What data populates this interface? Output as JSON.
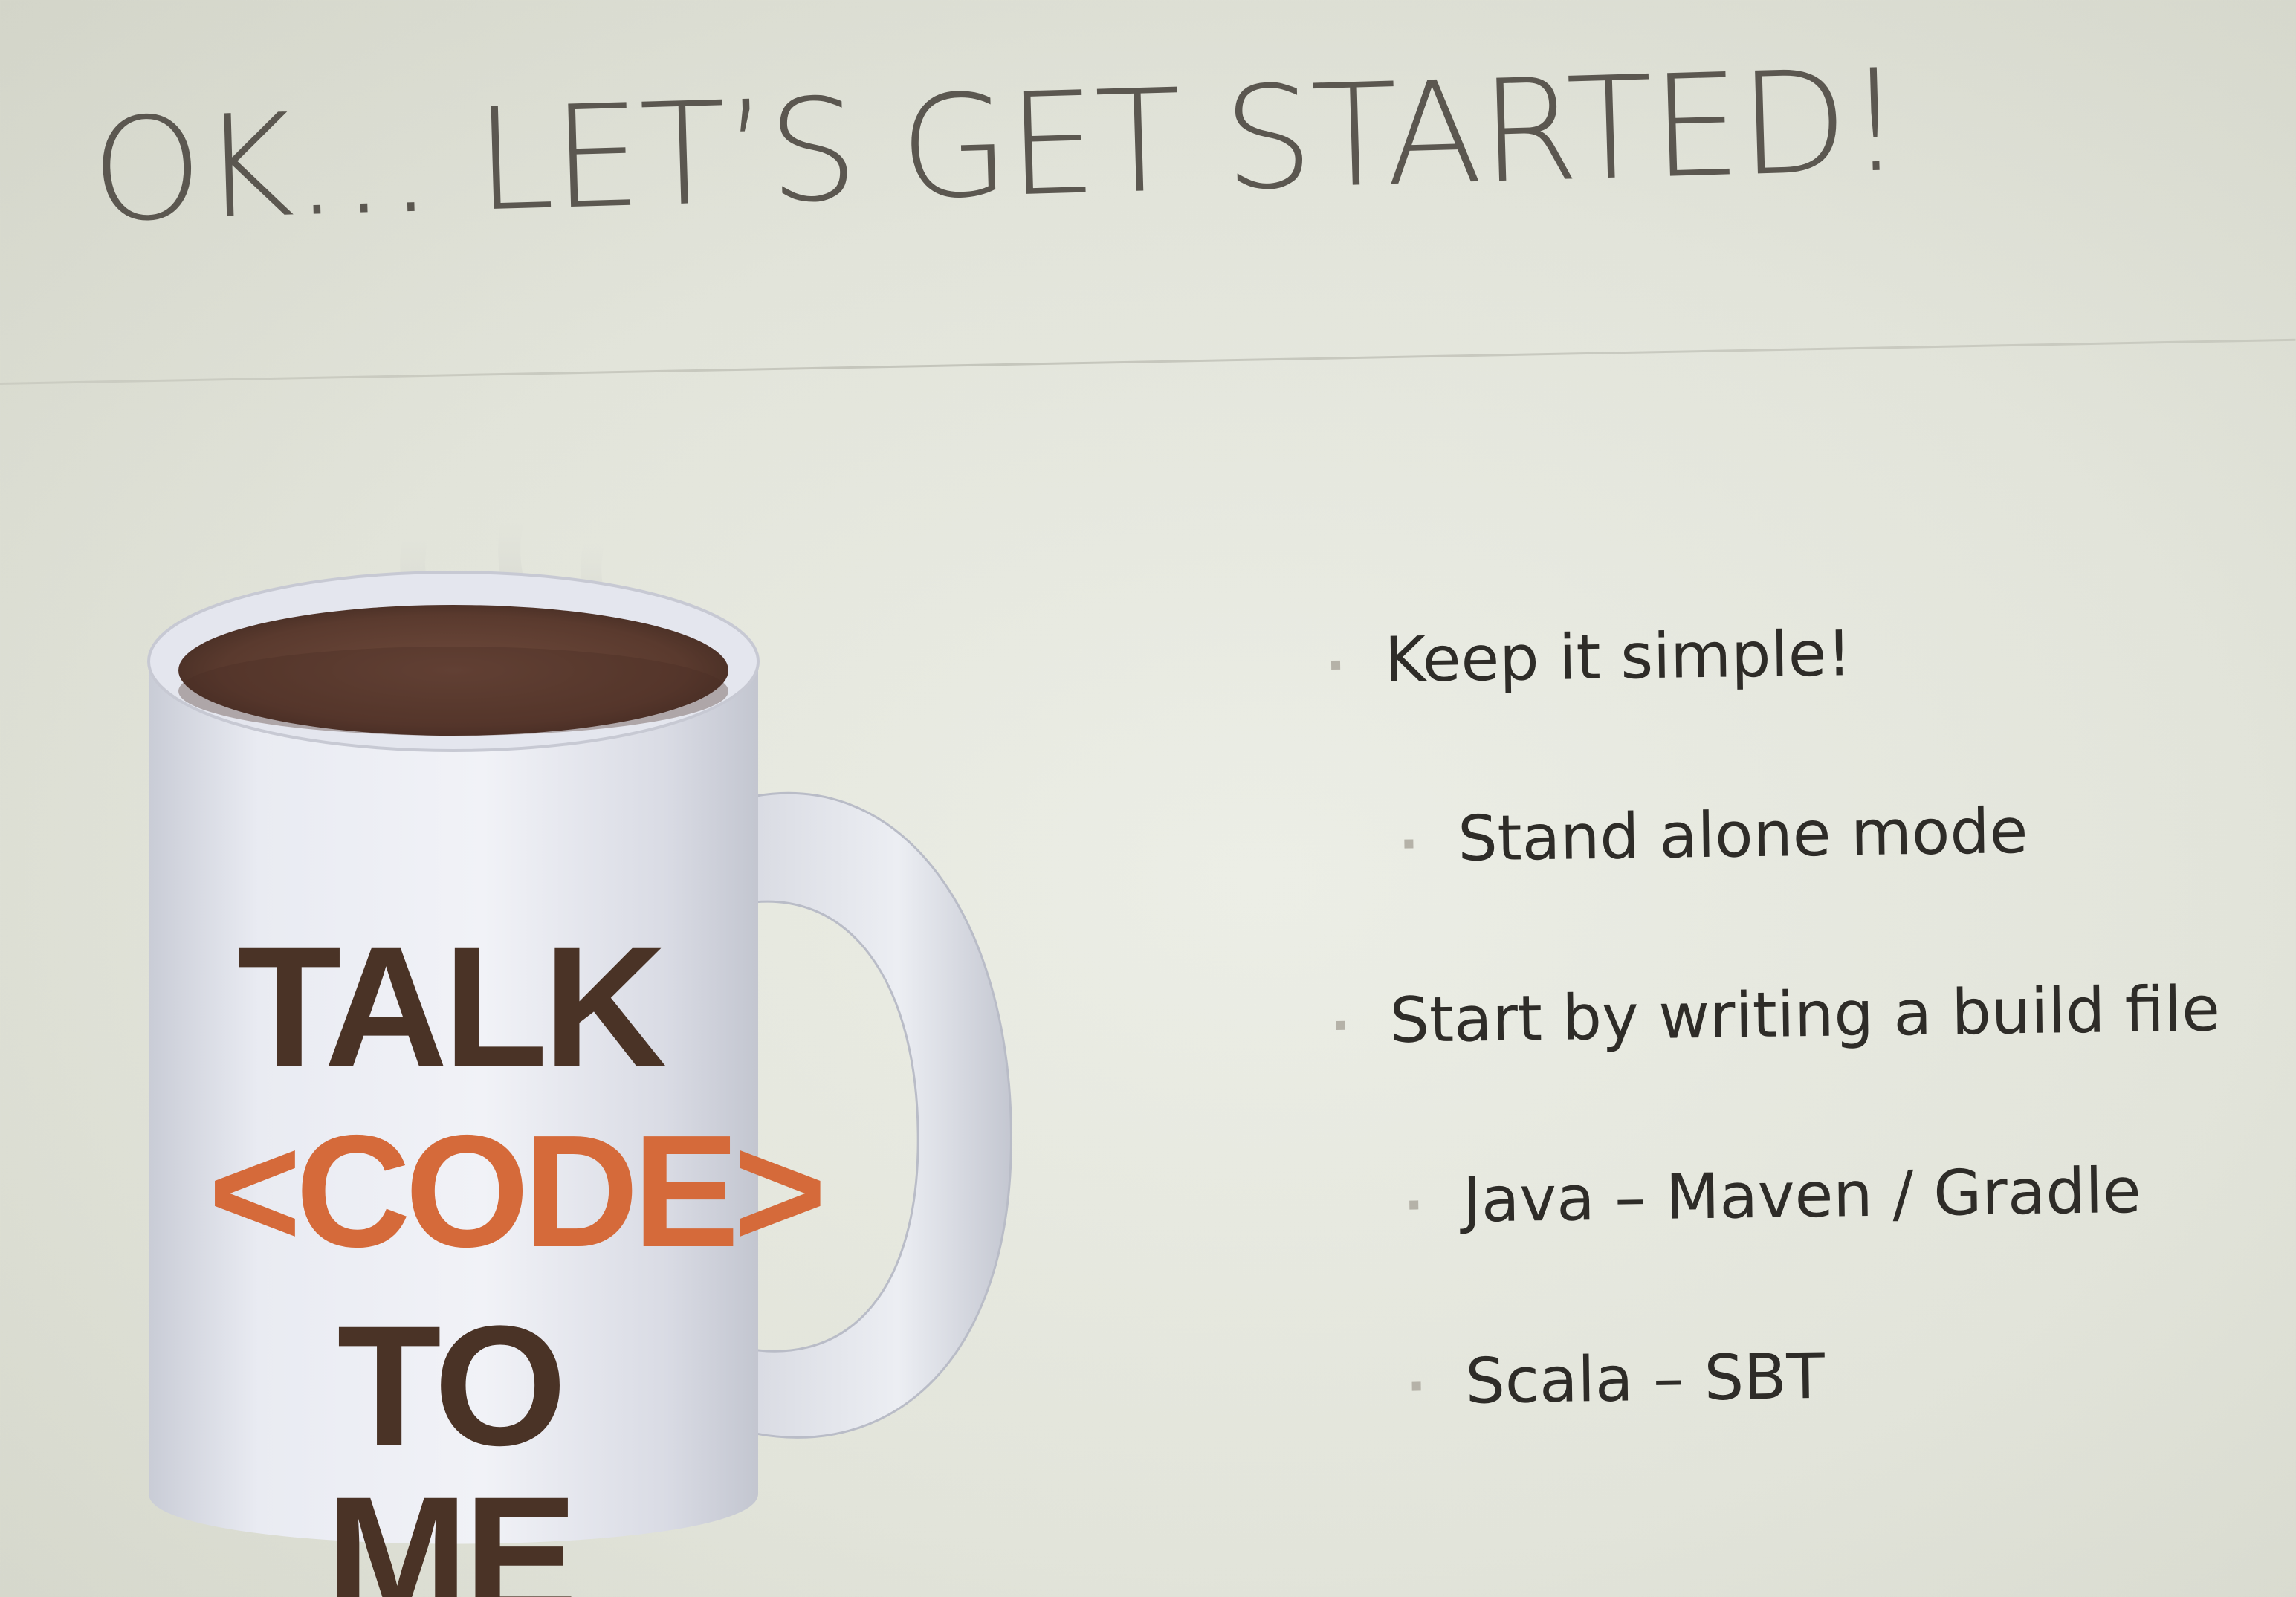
{
  "slide": {
    "title": "OK… LET’S GET STARTED!",
    "mug": {
      "line1": "TALK",
      "line2": "<CODE>",
      "line3": "TO ME"
    },
    "bullets": [
      {
        "text": "Keep it simple!",
        "level": 1
      },
      {
        "text": "Stand alone mode",
        "level": 2
      },
      {
        "text": "Start by writing a build file",
        "level": 1
      },
      {
        "text": "Java – Maven  / Gradle",
        "level": 2
      },
      {
        "text": "Scala – SBT",
        "level": 2
      }
    ]
  },
  "colors": {
    "title": "#5b5750",
    "mug_dark_text": "#4a3326",
    "mug_accent_text": "#d56a3a",
    "bullet_text": "#2e2c28",
    "background": "#e6e8de"
  }
}
